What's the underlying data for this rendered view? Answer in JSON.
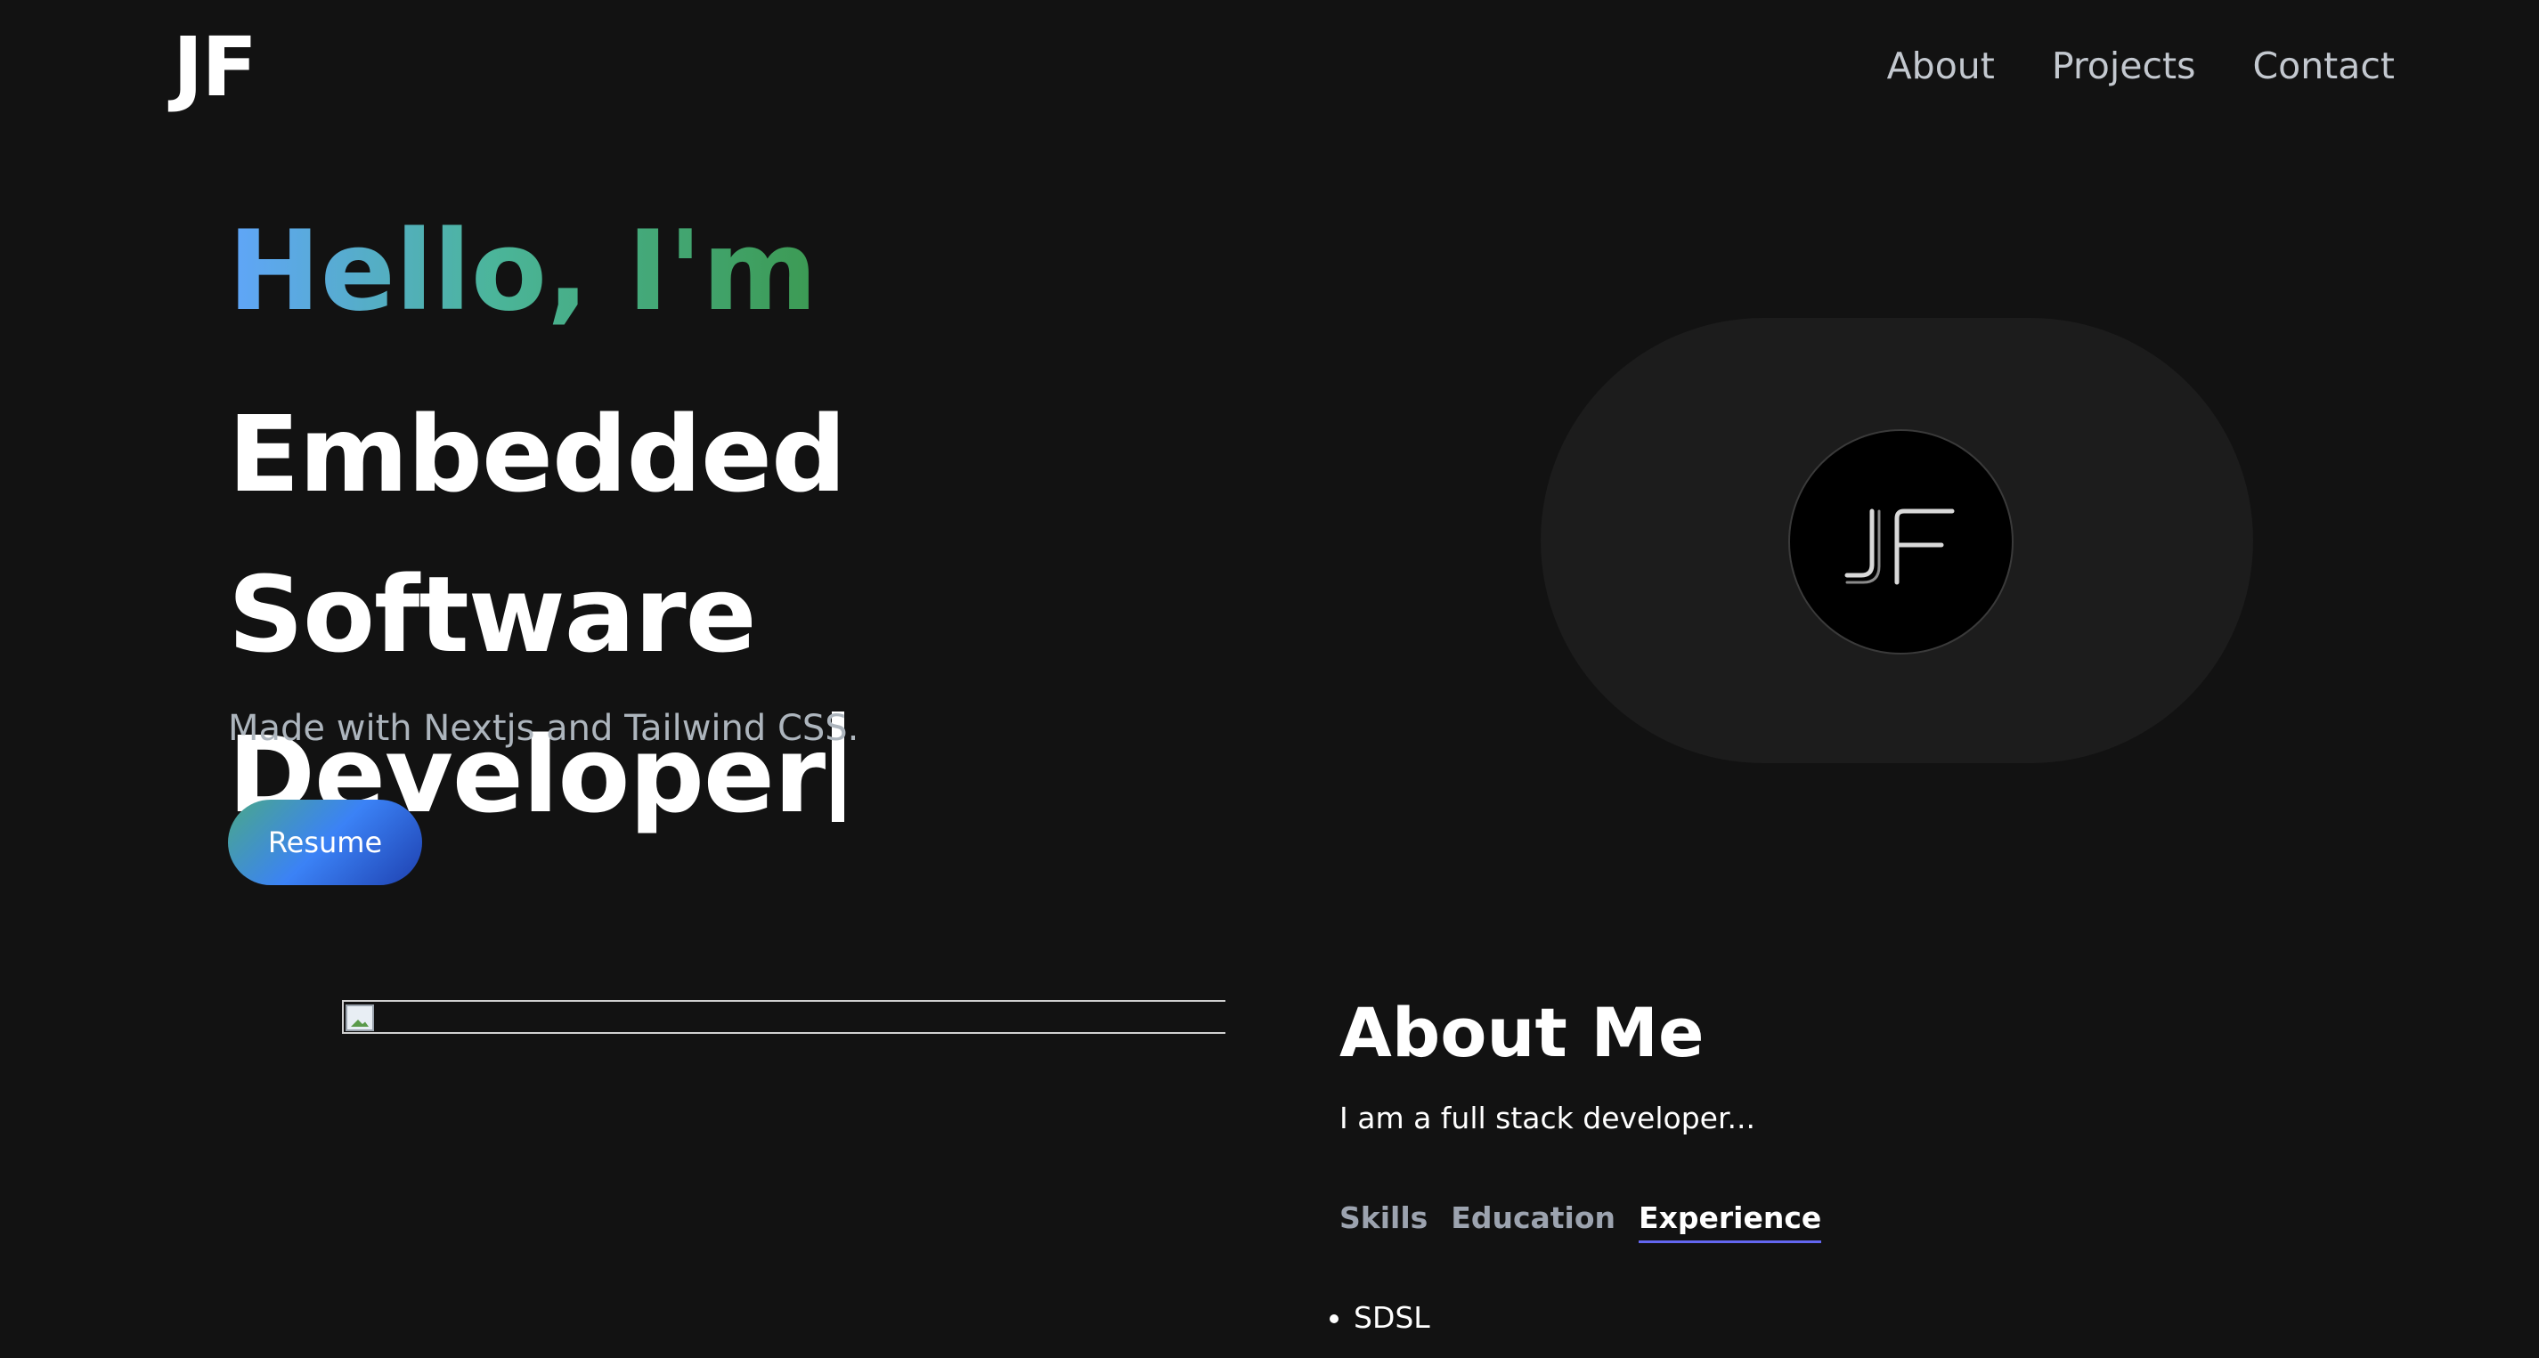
{
  "nav": {
    "logo": "JF",
    "links": [
      "About",
      "Projects",
      "Contact"
    ]
  },
  "hero": {
    "greeting": "Hello, I'm",
    "title": "Embedded Software Developer",
    "subtitle": "Made with Nextjs and Tailwind CSS.",
    "button_label": "Resume"
  },
  "avatar": {
    "monogram": "JF"
  },
  "about": {
    "title": "About Me",
    "text": "I am a full stack developer...",
    "tabs": [
      "Skills",
      "Education",
      "Experience"
    ],
    "active_tab": "Experience",
    "items": [
      "SDSL"
    ]
  },
  "colors": {
    "background": "#121212",
    "accent_blue": "#60a5fa",
    "accent_green": "#3c9a53",
    "tab_underline": "#6366f1"
  }
}
